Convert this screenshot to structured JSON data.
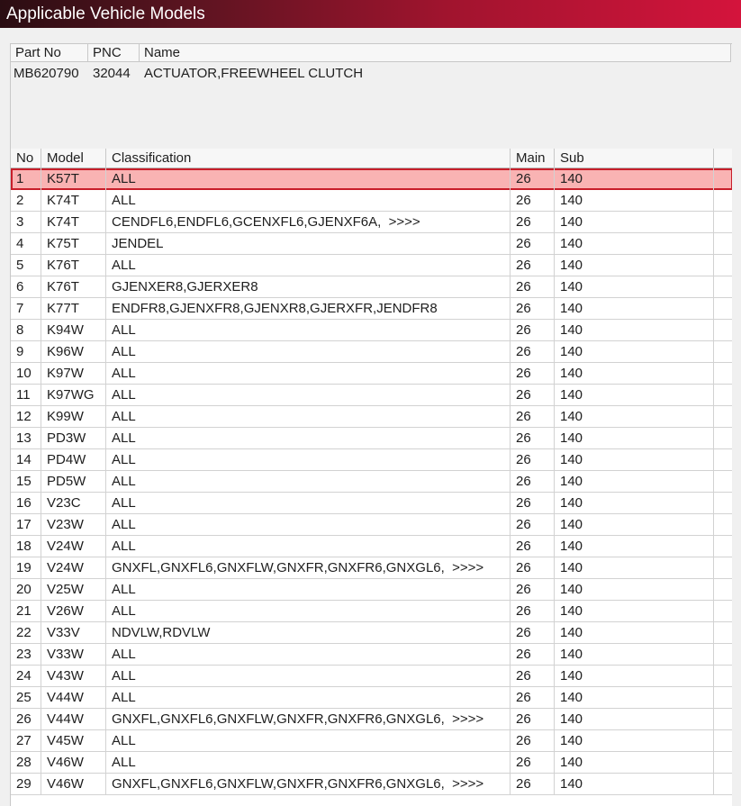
{
  "window": {
    "title": "Applicable Vehicle Models"
  },
  "part": {
    "headers": {
      "part_no": "Part No",
      "pnc": "PNC",
      "name": "Name"
    },
    "part_no": "MB620790",
    "pnc": "32044",
    "name": "ACTUATOR,FREEWHEEL CLUTCH"
  },
  "grid": {
    "columns": {
      "no": "No",
      "model": "Model",
      "classification": "Classification",
      "main": "Main",
      "sub": "Sub"
    },
    "selected_row": 1,
    "rows": [
      {
        "no": "1",
        "model": "K57T",
        "classification": "ALL",
        "main": "26",
        "sub": "140"
      },
      {
        "no": "2",
        "model": "K74T",
        "classification": "ALL",
        "main": "26",
        "sub": "140"
      },
      {
        "no": "3",
        "model": "K74T",
        "classification": "CENDFL6,ENDFL6,GCENXFL6,GJENXF6A,  >>>>",
        "main": "26",
        "sub": "140"
      },
      {
        "no": "4",
        "model": "K75T",
        "classification": "JENDEL",
        "main": "26",
        "sub": "140"
      },
      {
        "no": "5",
        "model": "K76T",
        "classification": "ALL",
        "main": "26",
        "sub": "140"
      },
      {
        "no": "6",
        "model": "K76T",
        "classification": "GJENXER8,GJERXER8",
        "main": "26",
        "sub": "140"
      },
      {
        "no": "7",
        "model": "K77T",
        "classification": "ENDFR8,GJENXFR8,GJENXR8,GJERXFR,JENDFR8",
        "main": "26",
        "sub": "140"
      },
      {
        "no": "8",
        "model": "K94W",
        "classification": "ALL",
        "main": "26",
        "sub": "140"
      },
      {
        "no": "9",
        "model": "K96W",
        "classification": "ALL",
        "main": "26",
        "sub": "140"
      },
      {
        "no": "10",
        "model": "K97W",
        "classification": "ALL",
        "main": "26",
        "sub": "140"
      },
      {
        "no": "11",
        "model": "K97WG",
        "classification": "ALL",
        "main": "26",
        "sub": "140"
      },
      {
        "no": "12",
        "model": "K99W",
        "classification": "ALL",
        "main": "26",
        "sub": "140"
      },
      {
        "no": "13",
        "model": "PD3W",
        "classification": "ALL",
        "main": "26",
        "sub": "140"
      },
      {
        "no": "14",
        "model": "PD4W",
        "classification": "ALL",
        "main": "26",
        "sub": "140"
      },
      {
        "no": "15",
        "model": "PD5W",
        "classification": "ALL",
        "main": "26",
        "sub": "140"
      },
      {
        "no": "16",
        "model": "V23C",
        "classification": "ALL",
        "main": "26",
        "sub": "140"
      },
      {
        "no": "17",
        "model": "V23W",
        "classification": "ALL",
        "main": "26",
        "sub": "140"
      },
      {
        "no": "18",
        "model": "V24W",
        "classification": "ALL",
        "main": "26",
        "sub": "140"
      },
      {
        "no": "19",
        "model": "V24W",
        "classification": "GNXFL,GNXFL6,GNXFLW,GNXFR,GNXFR6,GNXGL6,  >>>>",
        "main": "26",
        "sub": "140"
      },
      {
        "no": "20",
        "model": "V25W",
        "classification": "ALL",
        "main": "26",
        "sub": "140"
      },
      {
        "no": "21",
        "model": "V26W",
        "classification": "ALL",
        "main": "26",
        "sub": "140"
      },
      {
        "no": "22",
        "model": "V33V",
        "classification": "NDVLW,RDVLW",
        "main": "26",
        "sub": "140"
      },
      {
        "no": "23",
        "model": "V33W",
        "classification": "ALL",
        "main": "26",
        "sub": "140"
      },
      {
        "no": "24",
        "model": "V43W",
        "classification": "ALL",
        "main": "26",
        "sub": "140"
      },
      {
        "no": "25",
        "model": "V44W",
        "classification": "ALL",
        "main": "26",
        "sub": "140"
      },
      {
        "no": "26",
        "model": "V44W",
        "classification": "GNXFL,GNXFL6,GNXFLW,GNXFR,GNXFR6,GNXGL6,  >>>>",
        "main": "26",
        "sub": "140"
      },
      {
        "no": "27",
        "model": "V45W",
        "classification": "ALL",
        "main": "26",
        "sub": "140"
      },
      {
        "no": "28",
        "model": "V46W",
        "classification": "ALL",
        "main": "26",
        "sub": "140"
      },
      {
        "no": "29",
        "model": "V46W",
        "classification": "GNXFL,GNXFL6,GNXFLW,GNXFR,GNXFR6,GNXGL6,  >>>>",
        "main": "26",
        "sub": "140"
      }
    ]
  },
  "colors": {
    "title_gradient_start": "#2a0d12",
    "title_gradient_end": "#d4143c",
    "selected_row_fill": "#f9b3b3",
    "selected_row_border": "#c81e2a"
  }
}
